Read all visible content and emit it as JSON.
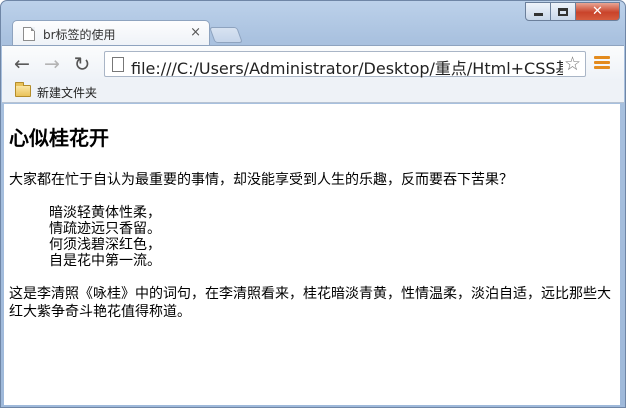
{
  "browser": {
    "tab": {
      "title": "br标签的使用",
      "close_glyph": "×"
    },
    "toolbar": {
      "url": "file:///C:/Users/Administrator/Desktop/重点/Html+CSS基",
      "back_glyph": "←",
      "forward_glyph": "→",
      "reload_glyph": "↻",
      "star_glyph": "☆"
    },
    "bookmarks": {
      "items": [
        {
          "label": "新建文件夹",
          "icon": "folder-icon"
        }
      ]
    },
    "window_controls": {
      "close_glyph": "✕"
    }
  },
  "page": {
    "heading": "心似桂花开",
    "intro": "大家都在忙于自认为最重要的事情，却没能享受到人生的乐趣，反而要吞下苦果？",
    "poem": [
      "暗淡轻黄体性柔，",
      "情疏迹远只香留。",
      "何须浅碧深红色，",
      "自是花中第一流。"
    ],
    "commentary": "这是李清照《咏桂》中的词句，在李清照看来，桂花暗淡青黄，性情温柔，淡泊自适，远比那些大红大紫争奇斗艳花值得称道。"
  }
}
